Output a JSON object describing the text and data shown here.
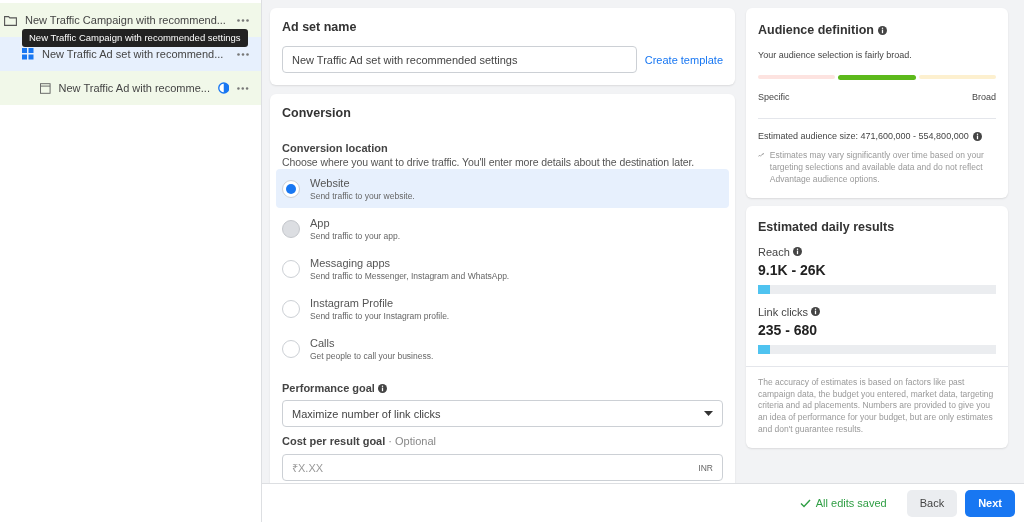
{
  "tree": [
    {
      "label": "New Traffic Campaign with recommend...",
      "kind": "campaign",
      "selected": false,
      "children": [
        {
          "label": "New Traffic Ad set with recommend...",
          "kind": "adset",
          "selected": true,
          "children": [
            {
              "label": "New Traffic Ad with recomme...",
              "kind": "ad",
              "selected": false
            }
          ]
        }
      ]
    }
  ],
  "tooltip": "New Traffic Campaign with recommended settings",
  "ad_set_name": {
    "title": "Ad set name",
    "value": "New Traffic Ad set with recommended settings",
    "link": "Create template"
  },
  "conversion": {
    "title": "Conversion",
    "location_label": "Conversion location",
    "location_hint": "Choose where you want to drive traffic. You'll enter more details about the destination later.",
    "options": [
      {
        "label": "Website",
        "description": "Send traffic to your website.",
        "selected": true,
        "disabled": false
      },
      {
        "label": "App",
        "description": "Send traffic to your app.",
        "selected": false,
        "disabled": true
      },
      {
        "label": "Messaging apps",
        "description": "Send traffic to Messenger, Instagram and WhatsApp.",
        "selected": false,
        "disabled": false
      },
      {
        "label": "Instagram Profile",
        "description": "Send traffic to your Instagram profile.",
        "selected": false,
        "disabled": false
      },
      {
        "label": "Calls",
        "description": "Get people to call your business.",
        "selected": false,
        "disabled": false
      }
    ],
    "performance_goal_label": "Performance goal",
    "performance_goal": "Maximize number of link clicks",
    "cost_label": "Cost per result goal",
    "cost_optional": "· Optional",
    "cost_placeholder": "₹X.XX",
    "currency": "INR"
  },
  "audience": {
    "title": "Audience definition",
    "summary": "Your audience selection is fairly broad.",
    "meter": [
      {
        "color": "#fde3e0",
        "selected": false
      },
      {
        "color": "#5cb91b",
        "selected": true
      },
      {
        "color": "#fdf0cf",
        "selected": false
      }
    ],
    "low": "Specific",
    "high": "Broad",
    "size": "Estimated audience size: 471,600,000 - 554,800,000",
    "note": "Estimates may vary significantly over time based on your targeting selections and available data and do not reflect Advantage audience options."
  },
  "daily": {
    "title": "Estimated daily results",
    "metrics": [
      {
        "label": "Reach",
        "value": "9.1K - 26K",
        "level": 0.05
      },
      {
        "label": "Link clicks",
        "value": "235 - 680",
        "level": 0.05
      }
    ],
    "note": "The accuracy of estimates is based on factors like past campaign data, the budget you entered, market data, targeting criteria and ad placements. Numbers are provided to give you an idea of performance for your budget, but are only estimates and don't guarantee results."
  },
  "footer": {
    "status": "All edits saved",
    "buttons": [
      {
        "label": "Back",
        "kind": "secondary"
      },
      {
        "label": "Next",
        "kind": "primary"
      }
    ]
  }
}
